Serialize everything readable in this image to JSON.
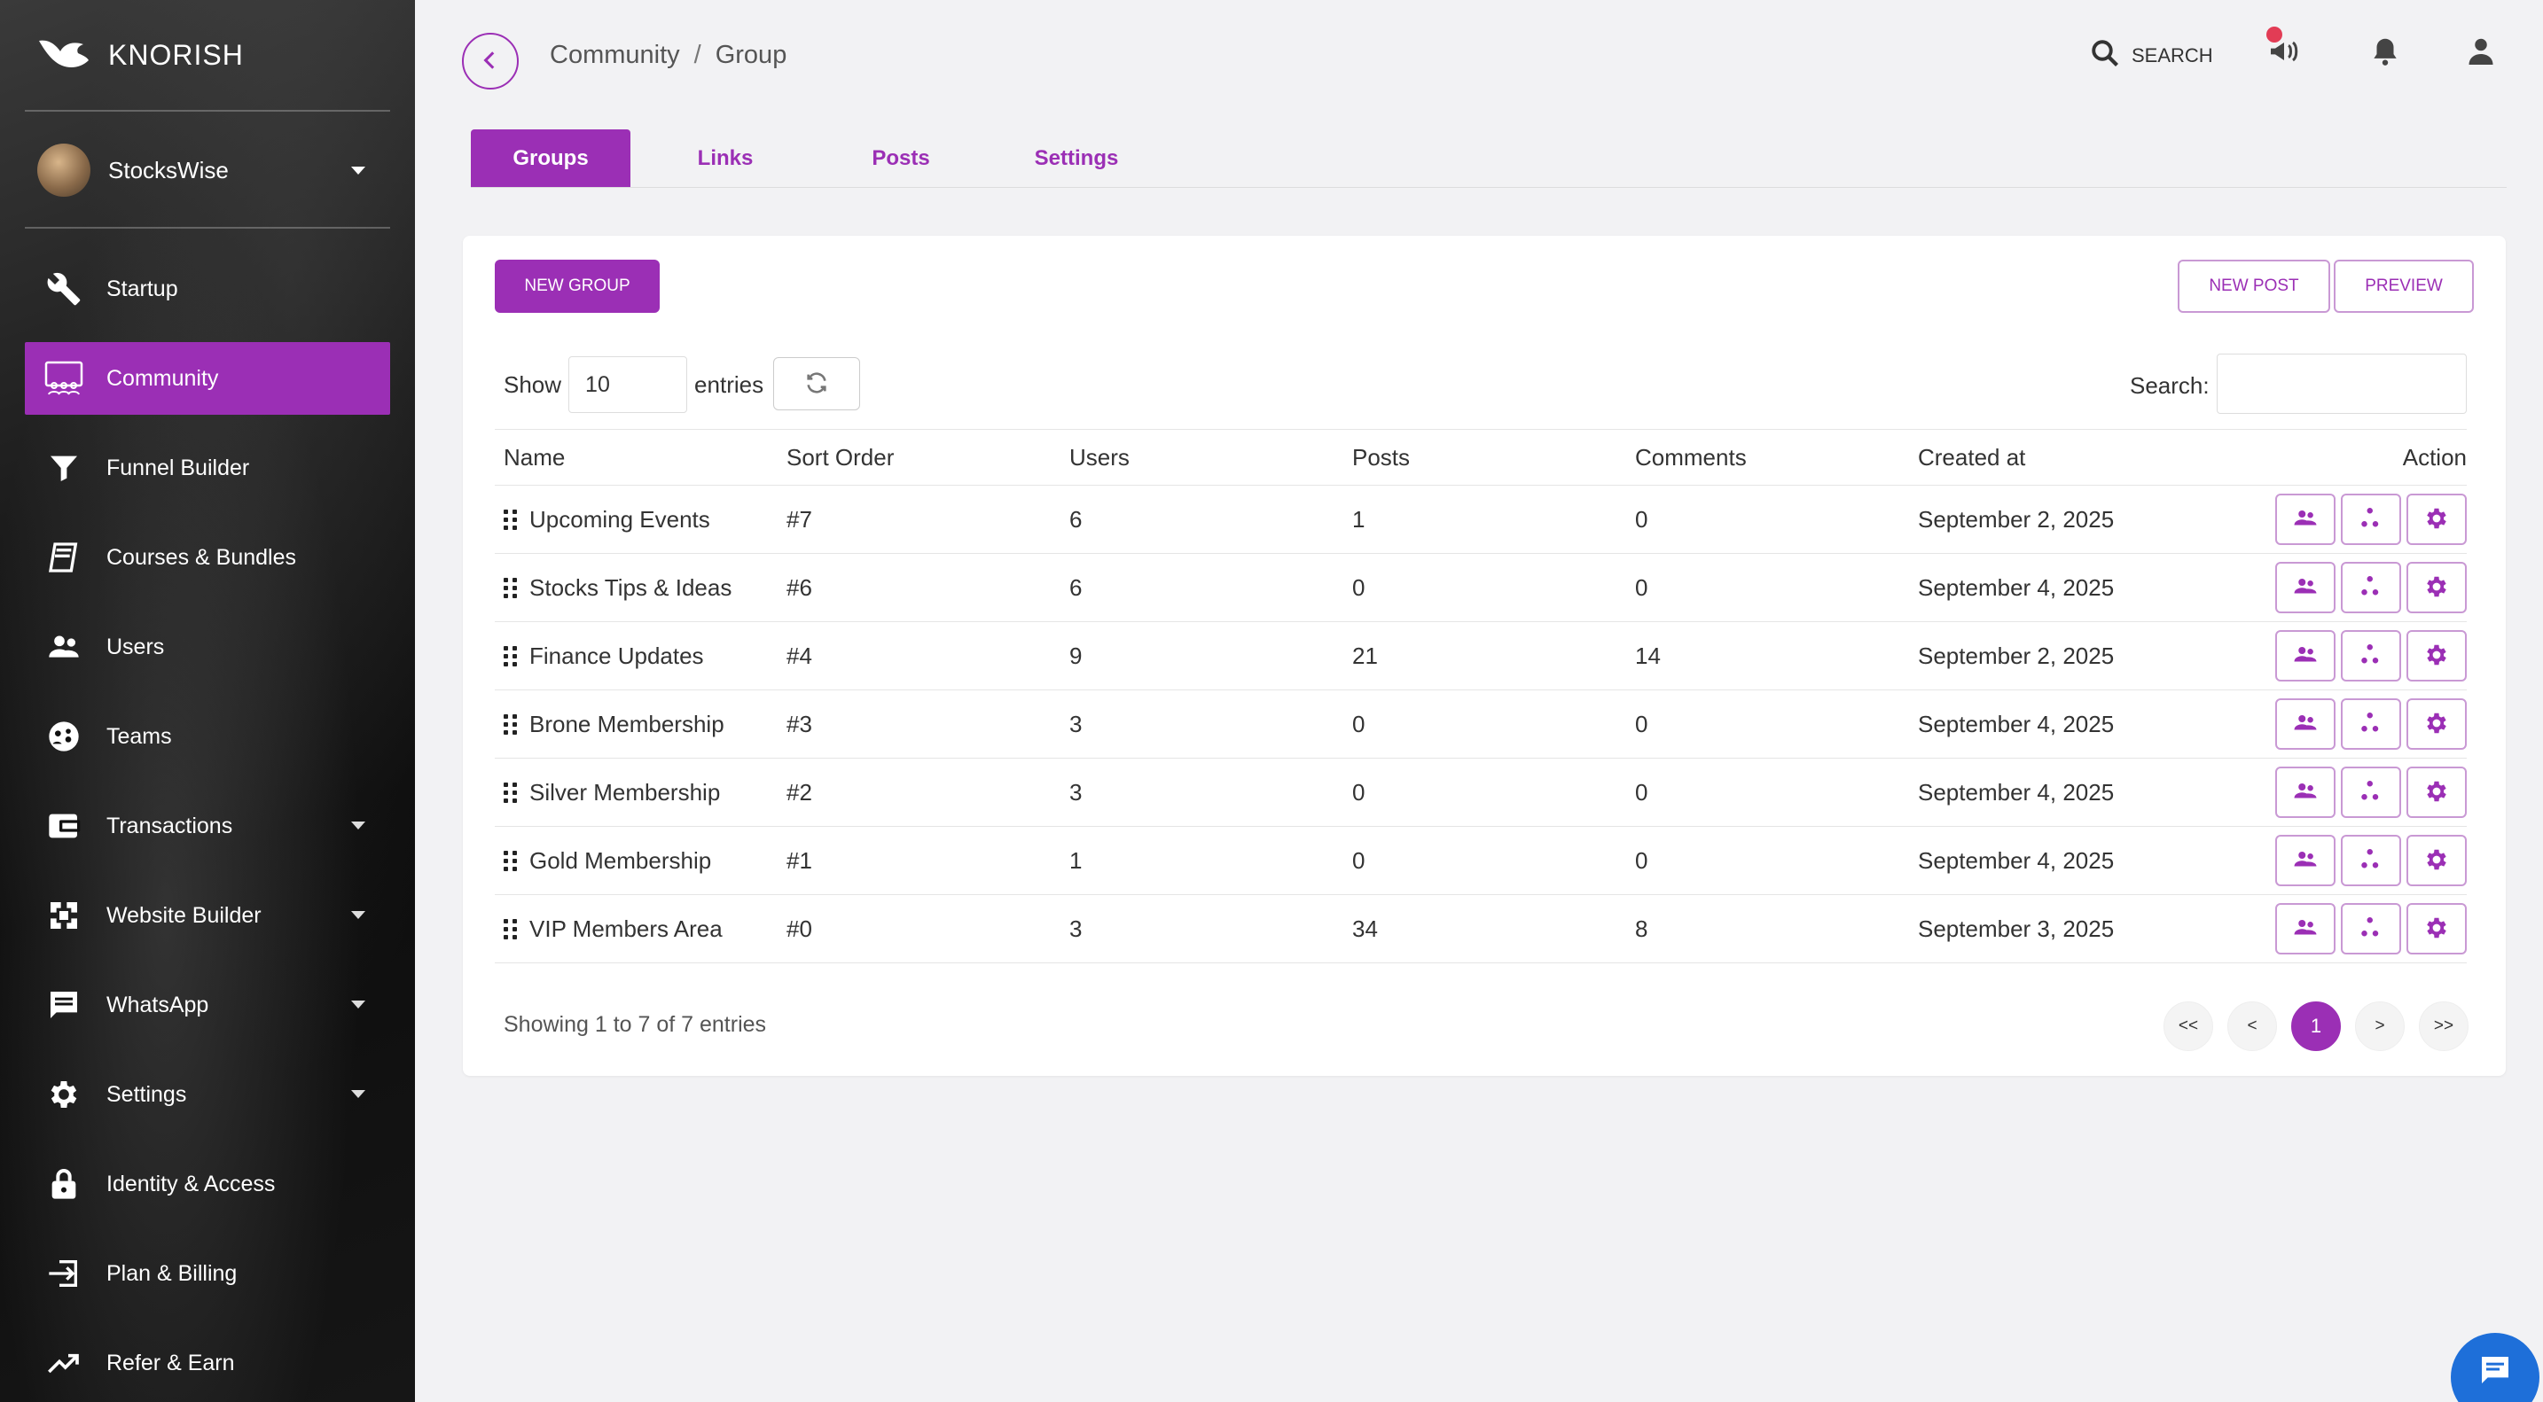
{
  "brand": {
    "name": "KNORISH"
  },
  "account": {
    "name": "StocksWise"
  },
  "nav": [
    {
      "label": "Startup",
      "icon": "wrench-icon"
    },
    {
      "label": "Community",
      "icon": "community-icon",
      "active": true
    },
    {
      "label": "Funnel Builder",
      "icon": "funnel-icon"
    },
    {
      "label": "Courses & Bundles",
      "icon": "book-icon"
    },
    {
      "label": "Users",
      "icon": "users-icon"
    },
    {
      "label": "Teams",
      "icon": "teams-icon"
    },
    {
      "label": "Transactions",
      "icon": "wallet-icon",
      "expandable": true
    },
    {
      "label": "Website Builder",
      "icon": "website-icon",
      "expandable": true
    },
    {
      "label": "WhatsApp",
      "icon": "message-icon",
      "expandable": true
    },
    {
      "label": "Settings",
      "icon": "gear-icon",
      "expandable": true
    },
    {
      "label": "Identity & Access",
      "icon": "lock-icon"
    },
    {
      "label": "Plan & Billing",
      "icon": "billing-icon"
    },
    {
      "label": "Refer & Earn",
      "icon": "trend-icon"
    }
  ],
  "header": {
    "breadcrumb": [
      "Community",
      "Group"
    ],
    "breadcrumb_sep": "/",
    "search_label": "SEARCH"
  },
  "tabs": [
    "Groups",
    "Links",
    "Posts",
    "Settings"
  ],
  "toolbar": {
    "new_group": "NEW GROUP",
    "new_post": "NEW POST",
    "preview": "PREVIEW",
    "show_label": "Show",
    "entries_value": "10",
    "entries_label": "entries",
    "search_label": "Search:"
  },
  "table": {
    "columns": [
      "Name",
      "Sort Order",
      "Users",
      "Posts",
      "Comments",
      "Created at",
      "Action"
    ],
    "rows": [
      {
        "name": "Upcoming Events",
        "sort": "#7",
        "users": "6",
        "posts": "1",
        "comments": "0",
        "created": "September 2, 2025"
      },
      {
        "name": "Stocks Tips & Ideas",
        "sort": "#6",
        "users": "6",
        "posts": "0",
        "comments": "0",
        "created": "September 4, 2025"
      },
      {
        "name": "Finance Updates",
        "sort": "#4",
        "users": "9",
        "posts": "21",
        "comments": "14",
        "created": "September 2, 2025"
      },
      {
        "name": "Brone Membership",
        "sort": "#3",
        "users": "3",
        "posts": "0",
        "comments": "0",
        "created": "September 4, 2025"
      },
      {
        "name": "Silver Membership",
        "sort": "#2",
        "users": "3",
        "posts": "0",
        "comments": "0",
        "created": "September 4, 2025"
      },
      {
        "name": "Gold Membership",
        "sort": "#1",
        "users": "1",
        "posts": "0",
        "comments": "0",
        "created": "September 4, 2025"
      },
      {
        "name": "VIP Members Area",
        "sort": "#0",
        "users": "3",
        "posts": "34",
        "comments": "8",
        "created": "September 3, 2025"
      }
    ]
  },
  "footer": {
    "showing": "Showing 1 to 7 of 7 entries",
    "pager": [
      "<<",
      "<",
      "1",
      ">",
      ">>"
    ],
    "current_page": "1"
  },
  "colors": {
    "accent": "#9b2fb5",
    "chat": "#1e6fd9",
    "notify": "#e23c55"
  }
}
